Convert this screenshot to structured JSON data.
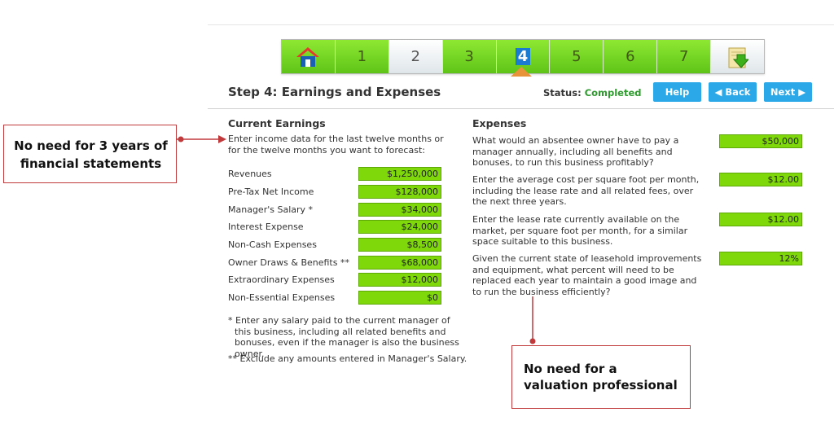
{
  "steps": [
    "1",
    "2",
    "3",
    "4",
    "5",
    "6",
    "7"
  ],
  "header": {
    "title": "Step 4: Earnings and Expenses",
    "status_label": "Status:",
    "status_value": "Completed",
    "help": "Help",
    "back": "Back",
    "next": "Next"
  },
  "earnings": {
    "heading": "Current Earnings",
    "intro": "Enter income data for the last twelve months or for the twelve months you want to forecast:",
    "rows": [
      {
        "label": "Revenues",
        "value": "$1,250,000"
      },
      {
        "label": "Pre-Tax Net Income",
        "value": "$128,000"
      },
      {
        "label": "Manager's Salary *",
        "value": "$34,000"
      },
      {
        "label": "Interest Expense",
        "value": "$24,000"
      },
      {
        "label": "Non-Cash Expenses",
        "value": "$8,500"
      },
      {
        "label": "Owner Draws & Benefits **",
        "value": "$68,000"
      },
      {
        "label": "Extraordinary Expenses",
        "value": "$12,000"
      },
      {
        "label": "Non-Essential Expenses",
        "value": "$0"
      }
    ],
    "note1": "* Enter any salary paid to the current manager of this business, including all related benefits and bonuses, even if the manager is also the business owner.",
    "note2": "** Exclude any amounts entered in Manager's Salary."
  },
  "expenses": {
    "heading": "Expenses",
    "rows": [
      {
        "question": "What would an absentee owner have to pay a manager annually, including all benefits and bonuses, to run this business profitably?",
        "value": "$50,000"
      },
      {
        "question": "Enter the average cost per square foot per month, including the lease rate and all related fees, over the next three years.",
        "value": "$12.00"
      },
      {
        "question": "Enter the lease rate currently available on the market, per square foot per month, for a similar space suitable to this business.",
        "value": "$12.00"
      },
      {
        "question": "Given the current state of leasehold improvements and equipment, what percent will need to be replaced each year to maintain a good image and to run the business efficiently?",
        "value": "12%"
      }
    ]
  },
  "annotations": {
    "left": "No need for 3 years of financial statements",
    "bottom": "No need for a valuation professional"
  },
  "colors": {
    "accent": "#2aa8e8",
    "field": "#7ed80a",
    "annotation_border": "#c0393b",
    "status": "#2e9a2e"
  },
  "icons": {
    "home": "home-icon",
    "download": "download-icon",
    "back": "chevron-left-icon",
    "next": "chevron-right-icon"
  }
}
